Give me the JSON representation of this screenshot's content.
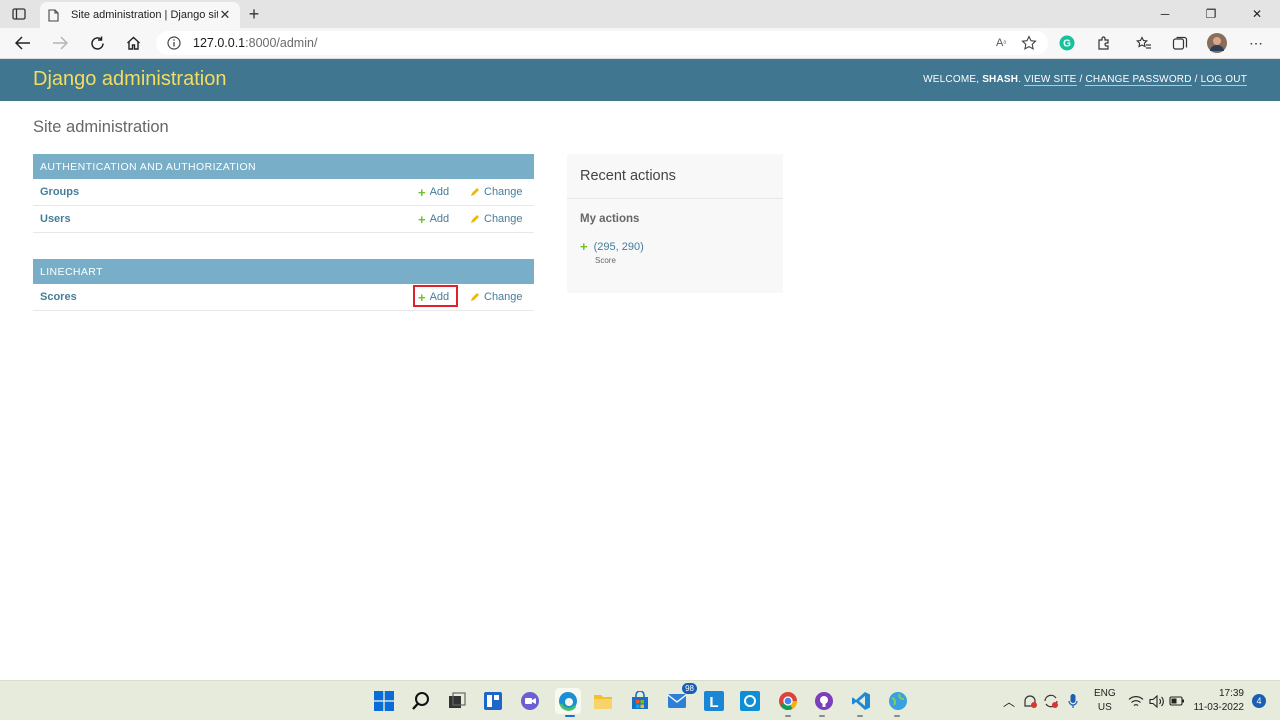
{
  "browser": {
    "tab_title": "Site administration | Django site",
    "url_host": "127.0.0.1",
    "url_path": ":8000/admin/"
  },
  "django": {
    "brand": "Django administration",
    "welcome": "WELCOME, ",
    "user": "SHASH",
    "links": {
      "view_site": "VIEW SITE",
      "change_password": "CHANGE PASSWORD",
      "log_out": "LOG OUT"
    },
    "sep": " / ",
    "page_title": "Site administration"
  },
  "modules": [
    {
      "caption": "AUTHENTICATION AND AUTHORIZATION",
      "models": [
        {
          "name": "Groups",
          "add": "Add",
          "change": "Change"
        },
        {
          "name": "Users",
          "add": "Add",
          "change": "Change"
        }
      ]
    },
    {
      "caption": "LINECHART",
      "models": [
        {
          "name": "Scores",
          "add": "Add",
          "change": "Change"
        }
      ]
    }
  ],
  "recent": {
    "title": "Recent actions",
    "subtitle": "My actions",
    "item_label": "(295, 290)",
    "item_type": "Score"
  },
  "taskbar": {
    "mail_badge": "98",
    "lang_top": "ENG",
    "lang_bottom": "US",
    "time": "17:39",
    "date": "11-03-2022",
    "notif_count": "4"
  },
  "colors": {
    "header_bg": "#417690",
    "brand": "#f5dd5d",
    "caption_bg": "#79aec8",
    "link": "#447e9b",
    "add_plus": "#70bf2b",
    "highlight": "#e0202a"
  }
}
